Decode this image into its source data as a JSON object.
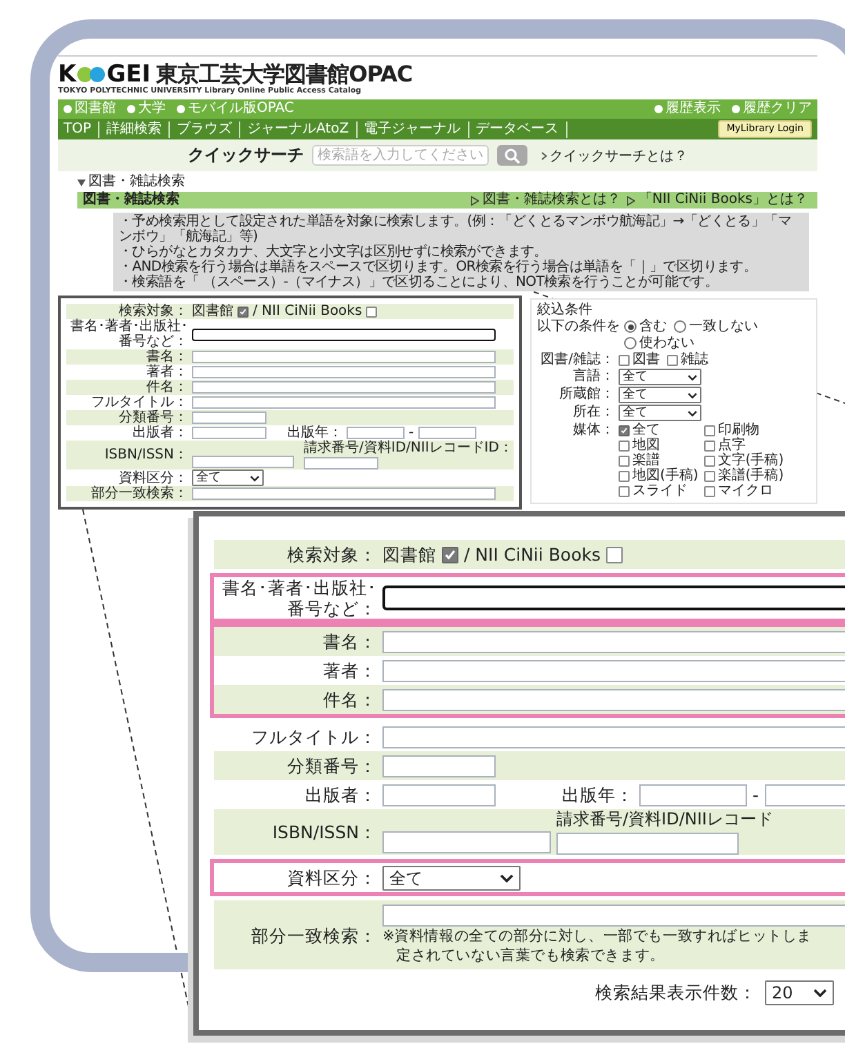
{
  "header": {
    "logo_initial": "K",
    "logo_letters": "GEI",
    "title": "東京工芸大学図書館OPAC",
    "subtitle": "TOKYO POLYTECHNIC UNIVERSITY Library Online Public Access Catalog"
  },
  "top_links": [
    "図書館",
    "大学",
    "モバイル版OPAC"
  ],
  "history_links": [
    "履歴表示",
    "履歴クリア"
  ],
  "nav": [
    "TOP",
    "詳細検索",
    "ブラウズ",
    "ジャーナルAtoZ",
    "電子ジャーナル",
    "データベース"
  ],
  "login_button": "MyLibrary Login",
  "quick_search": {
    "label": "クイックサーチ",
    "placeholder": "検索語を入力してください",
    "help_link": "クイックサーチとは？"
  },
  "breadcrumb": "図書・雑誌検索",
  "section": {
    "title": "図書・雑誌検索",
    "links": [
      "図書・雑誌検索とは？",
      "「NII CiNii Books」とは？"
    ]
  },
  "notes": [
    "・予め検索用として設定された単語を対象に検索します。(例：「どくとるマンボウ航海記」→「どくとる」「マンボウ」「航海記」等)",
    "・ひらがなとカタカナ、大文字と小文字は区別せずに検索ができます。",
    "・AND検索を行う場合は単語をスペースで区切ります。OR検索を行う場合は単語を「｜」で区切ります。",
    "・検索語を「 （スペース）-（マイナス）」で区切ることにより、NOT検索を行うことが可能です。"
  ],
  "search_form": {
    "groups": [
      {
        "highlighted": false,
        "rows": [
          {
            "kind": "checks",
            "label_lines": [
              "検索対象："
            ],
            "options": [
              {
                "label": "図書館",
                "checked": true
              },
              {
                "label": "/ NII CiNii Books",
                "checked": false
              }
            ]
          }
        ]
      },
      {
        "highlighted": false,
        "rows": [
          {
            "kind": "text",
            "label_lines": [
              "書名･著者･出版社･",
              "番号など："
            ],
            "focused": true
          }
        ]
      },
      {
        "highlighted": false,
        "rows": [
          {
            "kind": "text",
            "label_lines": [
              "書名："
            ],
            "focused": false
          },
          {
            "kind": "text",
            "label_lines": [
              "著者："
            ],
            "focused": false
          },
          {
            "kind": "text",
            "label_lines": [
              "件名："
            ],
            "focused": false
          }
        ]
      },
      {
        "highlighted": false,
        "rows": [
          {
            "kind": "text",
            "label_lines": [
              "フルタイトル："
            ],
            "focused": false
          },
          {
            "kind": "short_text",
            "label_lines": [
              "分類番号："
            ]
          },
          {
            "kind": "year_range",
            "label_lines": [
              "出版者："
            ],
            "second_label": "出版年：",
            "separator": "-"
          },
          {
            "kind": "call_number",
            "label_lines": [
              "ISBN/ISSN："
            ],
            "second_label": "請求番号/資料ID/NIIレコードID："
          }
        ]
      },
      {
        "highlighted": false,
        "rows": [
          {
            "kind": "select",
            "label_lines": [
              "資料区分："
            ],
            "value": "全て"
          }
        ]
      },
      {
        "highlighted": false,
        "rows": [
          {
            "kind": "partial",
            "label_lines": [
              "部分一致検索："
            ]
          }
        ]
      }
    ]
  },
  "filter_panel": {
    "title": "絞込条件",
    "condition_label": "以下の条件を",
    "conditions": [
      {
        "label": "含む",
        "selected": true
      },
      {
        "label": "一致しない",
        "selected": false
      },
      {
        "label": "使わない",
        "selected": false
      }
    ],
    "type_label": "図書/雑誌：",
    "types": [
      {
        "label": "図書",
        "checked": false
      },
      {
        "label": "雑誌",
        "checked": false
      }
    ],
    "selects": [
      {
        "label": "言語：",
        "value": "全て"
      },
      {
        "label": "所蔵館：",
        "value": "全て"
      },
      {
        "label": "所在：",
        "value": "全て"
      }
    ],
    "media_label": "媒体：",
    "media": [
      {
        "label": "全て",
        "checked": true
      },
      {
        "label": "印刷物",
        "checked": false
      },
      {
        "label": "地図",
        "checked": false
      },
      {
        "label": "点字",
        "checked": false
      },
      {
        "label": "楽譜",
        "checked": false
      },
      {
        "label": "文字(手稿)",
        "checked": false
      },
      {
        "label": "地図(手稿)",
        "checked": false
      },
      {
        "label": "楽譜(手稿)",
        "checked": false
      },
      {
        "label": "スライド",
        "checked": false
      },
      {
        "label": "マイクロ",
        "checked": false
      }
    ]
  },
  "zoom_inset": {
    "groups": [
      {
        "highlighted": false,
        "rows": [
          {
            "kind": "checks",
            "label_lines": [
              "検索対象："
            ],
            "options": [
              {
                "label": "図書館",
                "checked": true
              },
              {
                "label": "/ NII CiNii Books",
                "checked": false
              }
            ]
          }
        ]
      },
      {
        "highlighted": true,
        "rows": [
          {
            "kind": "text",
            "label_lines": [
              "書名･著者･出版社･",
              "番号など："
            ],
            "focused": true
          }
        ]
      },
      {
        "highlighted": true,
        "rows": [
          {
            "kind": "text",
            "label_lines": [
              "書名："
            ],
            "focused": false
          },
          {
            "kind": "text",
            "label_lines": [
              "著者："
            ],
            "focused": false
          },
          {
            "kind": "text",
            "label_lines": [
              "件名："
            ],
            "focused": false
          }
        ]
      },
      {
        "highlighted": false,
        "rows": [
          {
            "kind": "text",
            "label_lines": [
              "フルタイトル："
            ],
            "focused": false
          },
          {
            "kind": "short_text",
            "label_lines": [
              "分類番号："
            ]
          },
          {
            "kind": "year_range",
            "label_lines": [
              "出版者："
            ],
            "second_label": "出版年：",
            "separator": "-"
          },
          {
            "kind": "call_number",
            "label_lines": [
              "ISBN/ISSN："
            ],
            "second_label": "請求番号/資料ID/NIIレコード"
          }
        ]
      },
      {
        "highlighted": true,
        "rows": [
          {
            "kind": "select",
            "label_lines": [
              "資料区分："
            ],
            "value": "全て"
          }
        ]
      },
      {
        "highlighted": false,
        "rows": [
          {
            "kind": "partial",
            "label_lines": [
              "部分一致検索："
            ],
            "note_lines": [
              "※資料情報の全ての部分に対し、一部でも一致すればヒットしま",
              "定されていない言葉でも検索できます。"
            ]
          }
        ]
      }
    ],
    "results_per_page": {
      "label": "検索結果表示件数：",
      "value": "20"
    }
  }
}
